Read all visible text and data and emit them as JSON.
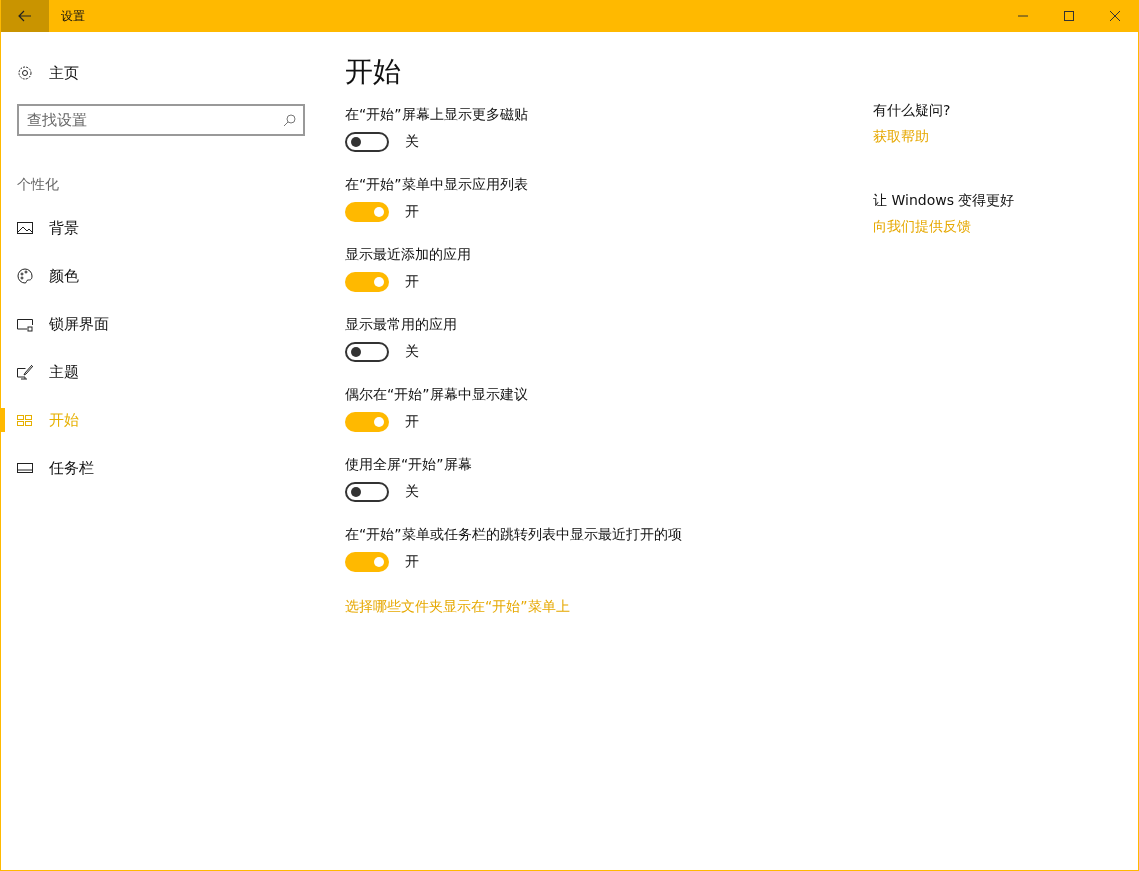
{
  "window": {
    "title": "设置"
  },
  "sidebar": {
    "home": "主页",
    "search": {
      "placeholder": "查找设置"
    },
    "section": "个性化",
    "items": [
      {
        "label": "背景",
        "selected": false
      },
      {
        "label": "颜色",
        "selected": false
      },
      {
        "label": "锁屏界面",
        "selected": false
      },
      {
        "label": "主题",
        "selected": false
      },
      {
        "label": "开始",
        "selected": true
      },
      {
        "label": "任务栏",
        "selected": false
      }
    ]
  },
  "page": {
    "title": "开始",
    "settings": [
      {
        "label": "在“开始”屏幕上显示更多磁贴",
        "on": false,
        "state_text": "关"
      },
      {
        "label": "在“开始”菜单中显示应用列表",
        "on": true,
        "state_text": "开"
      },
      {
        "label": "显示最近添加的应用",
        "on": true,
        "state_text": "开"
      },
      {
        "label": "显示最常用的应用",
        "on": false,
        "state_text": "关"
      },
      {
        "label": "偶尔在“开始”屏幕中显示建议",
        "on": true,
        "state_text": "开"
      },
      {
        "label": "使用全屏“开始”屏幕",
        "on": false,
        "state_text": "关"
      },
      {
        "label": "在“开始”菜单或任务栏的跳转列表中显示最近打开的项",
        "on": true,
        "state_text": "开"
      }
    ],
    "link": "选择哪些文件夹显示在“开始”菜单上"
  },
  "aside": [
    {
      "heading": "有什么疑问?",
      "link": "获取帮助"
    },
    {
      "heading": "让 Windows 变得更好",
      "link": "向我们提供反馈"
    }
  ]
}
